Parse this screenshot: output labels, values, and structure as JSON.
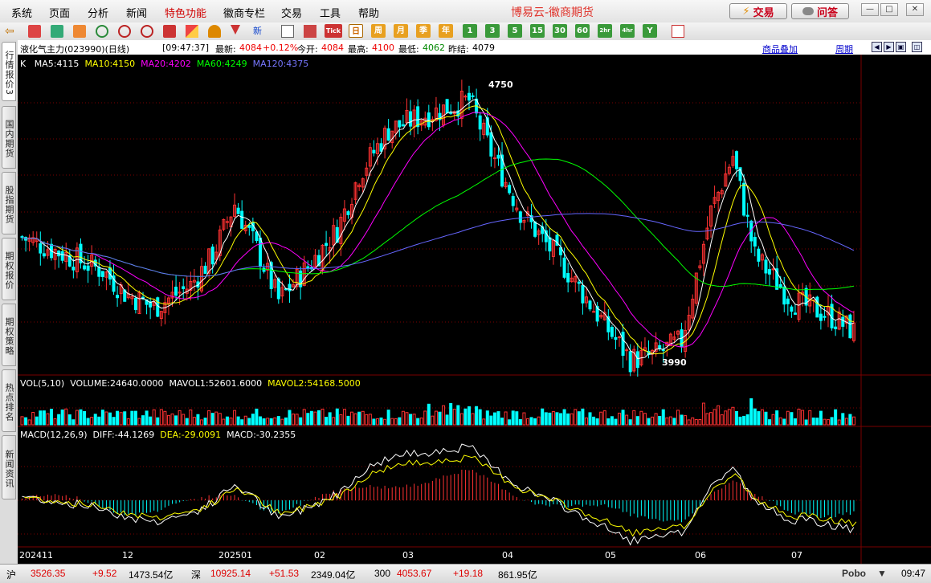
{
  "menu": [
    "系统",
    "页面",
    "分析",
    "新闻",
    "特色功能",
    "徽商专栏",
    "交易",
    "工具",
    "帮助"
  ],
  "app_title": "博易云-徽商期货",
  "trade_button": "交易",
  "ask_button": "问答",
  "toolbar_periods": [
    "日",
    "周",
    "月",
    "季",
    "年",
    "1",
    "3",
    "5",
    "15",
    "30",
    "60",
    "2hr",
    "4hr",
    "Y"
  ],
  "toolbar_new_label": "新",
  "toolbar_tick_label": "Tick",
  "left_tabs": [
    "行情报价",
    "国内期货",
    "股指期货",
    "期权报价",
    "期权策略",
    "热点排名",
    "新闻资讯"
  ],
  "left_top_num": "3",
  "info": {
    "name": "液化气主力(023990)(日线)",
    "time": "[09:47:37]",
    "latest_label": "最新:",
    "latest_value": "4084",
    "change": "+0.12%",
    "open_label": "今开:",
    "open_value": "4084",
    "high_label": "最高:",
    "high_value": "4100",
    "low_label": "最低:",
    "low_value": "4062",
    "prev_label": "昨结:",
    "prev_value": "4079",
    "overlay_link": "商品叠加",
    "period_link": "周期"
  },
  "ma_legend": {
    "k": "K",
    "ma5": "MA5:4115",
    "ma10": "MA10:4150",
    "ma20": "MA20:4202",
    "ma60": "MA60:4249",
    "ma120": "MA120:4375"
  },
  "vol_legend": {
    "title": "VOL(5,10)",
    "volume": "VOLUME:24640.0000",
    "mavol1": "MAVOL1:52601.6000",
    "mavol2": "MAVOL2:54168.5000"
  },
  "macd_legend": {
    "title": "MACD(12,26,9)",
    "diff": "DIFF:-44.1269",
    "dea": "DEA:-29.0091",
    "macd": "MACD:-30.2355"
  },
  "price_high_label": "4750",
  "price_low_label": "3990",
  "x_labels": [
    "202411",
    "12",
    "202501",
    "02",
    "03",
    "04",
    "05",
    "06",
    "07"
  ],
  "status": {
    "sh_label": "沪",
    "sh_index": "3526.35",
    "sh_change": "+9.52",
    "sh_amount": "1473.54亿",
    "sz_label": "深",
    "sz_index": "10925.14",
    "sz_change": "+51.53",
    "sz_amount": "2349.04亿",
    "hs_label": "300",
    "hs_index": "4053.67",
    "hs_change": "+19.18",
    "hs_amount": "861.95亿",
    "brand": "Pobo",
    "time": "09:47"
  },
  "colors": {
    "up": "#ff3232",
    "down": "#00ffff",
    "ma5": "#ffffff",
    "ma10": "#ffff00",
    "ma20": "#ff00ff",
    "ma60": "#00ff00",
    "ma120": "#6666ff"
  }
}
